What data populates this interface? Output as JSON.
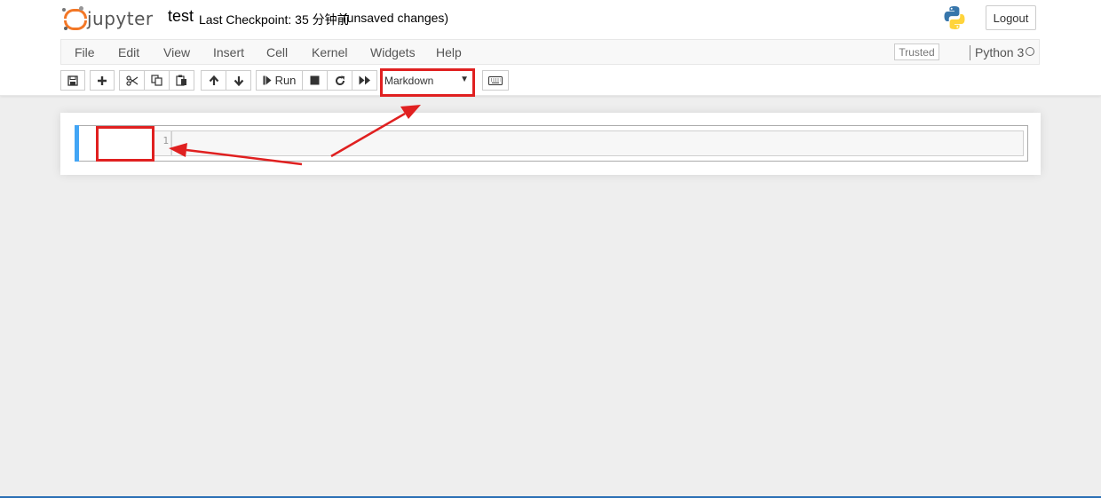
{
  "header": {
    "logo_text": "jupyter",
    "notebook_name": "test",
    "checkpoint": "Last Checkpoint: 35 分钟前",
    "autosave_status": "(unsaved changes)",
    "logout_label": "Logout"
  },
  "menubar": {
    "items": [
      "File",
      "Edit",
      "View",
      "Insert",
      "Cell",
      "Kernel",
      "Widgets",
      "Help"
    ],
    "trusted_label": "Trusted",
    "kernel_name": "Python 3"
  },
  "toolbar": {
    "run_label": "Run",
    "cell_type_selected": "Markdown",
    "icons": [
      "save-icon",
      "plus-icon",
      "cut-icon",
      "copy-icon",
      "paste-icon",
      "arrow-up-icon",
      "arrow-down-icon",
      "step-forward-icon",
      "stop-icon",
      "refresh-icon",
      "fast-forward-icon",
      "keyboard-icon"
    ]
  },
  "cell": {
    "line_number": "1",
    "content": ""
  },
  "colors": {
    "annotation": "#e02020",
    "cell_selected_bar": "#42a5f5",
    "jupyter_orange": "#f37726"
  }
}
